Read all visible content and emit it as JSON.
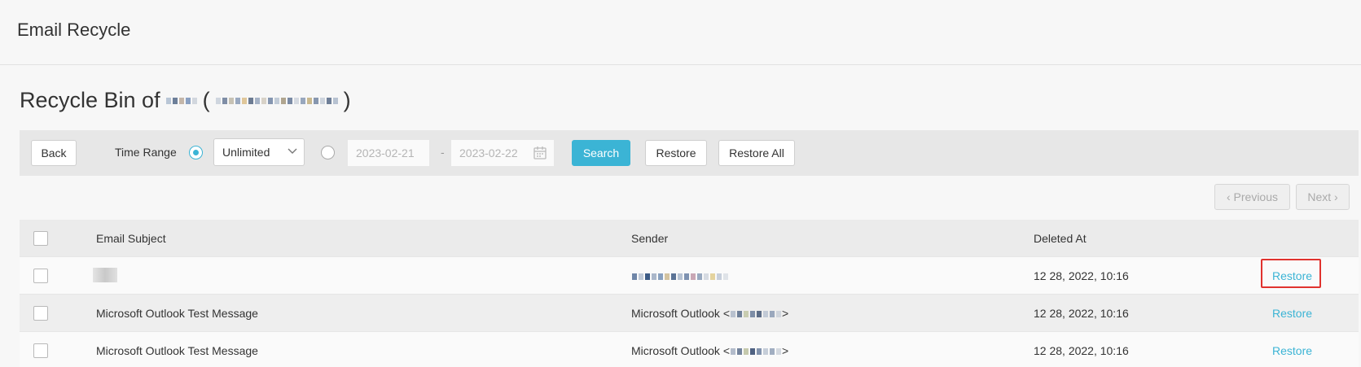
{
  "app": {
    "title": "Email Recycle"
  },
  "page": {
    "title_prefix": "Recycle Bin of",
    "title_open_paren": "(",
    "title_close_paren": ")"
  },
  "toolbar": {
    "back_label": "Back",
    "time_range_label": "Time Range",
    "range_option_selected": "Unlimited",
    "start_date": "2023-02-21",
    "date_separator": "-",
    "end_date": "2023-02-22",
    "search_label": "Search",
    "restore_label": "Restore",
    "restore_all_label": "Restore All"
  },
  "pager": {
    "previous_label": "‹ Previous",
    "next_label": "Next ›"
  },
  "table": {
    "columns": [
      "Email Subject",
      "Sender",
      "Deleted At"
    ],
    "rows": [
      {
        "subject": "",
        "sender": "",
        "deleted_at": "12 28, 2022, 10:16",
        "action": "Restore"
      },
      {
        "subject": "Microsoft Outlook Test Message",
        "sender": "Microsoft Outlook <",
        "sender_end": ">",
        "deleted_at": "12 28, 2022, 10:16",
        "action": "Restore"
      },
      {
        "subject": "Microsoft Outlook Test Message",
        "sender": "Microsoft Outlook <",
        "sender_end": ">",
        "deleted_at": "12 28, 2022, 10:16",
        "action": "Restore"
      }
    ]
  },
  "colors": {
    "accent": "#3bb4d5",
    "highlight": "#e0322e"
  },
  "icons": {
    "select_chevron": "chevron-down-icon",
    "date_picker": "calendar-icon"
  }
}
